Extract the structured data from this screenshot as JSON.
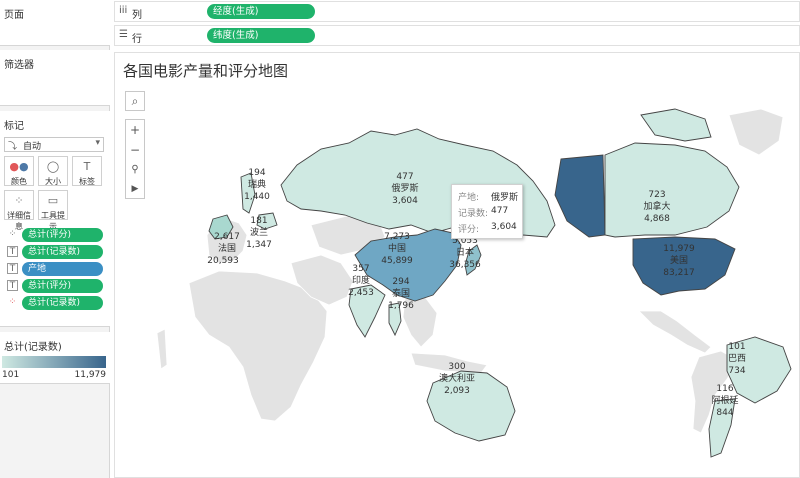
{
  "left_panel": {
    "pages_title": "页面",
    "filters_title": "筛选器",
    "marks": {
      "title": "标记",
      "mark_type": "自动",
      "buttons": [
        {
          "label": "颜色",
          "icon": "color-dots-icon"
        },
        {
          "label": "大小",
          "icon": "size-circles-icon"
        },
        {
          "label": "标签",
          "icon": "label-t-icon"
        },
        {
          "label": "详细信息",
          "icon": "detail-dots-icon"
        },
        {
          "label": "工具提示",
          "icon": "tooltip-bubble-icon"
        }
      ],
      "fields": [
        {
          "label": "总计(评分)",
          "type": "detail",
          "color": "#1fb36b"
        },
        {
          "label": "总计(记录数)",
          "type": "label",
          "color": "#1fb36b"
        },
        {
          "label": "产地",
          "type": "label",
          "color": "#3b8fc4"
        },
        {
          "label": "总计(评分)",
          "type": "label",
          "color": "#1fb36b"
        },
        {
          "label": "总计(记录数)",
          "type": "color",
          "color": "#1fb36b"
        }
      ]
    },
    "legend": {
      "title": "总计(记录数)",
      "min": "101",
      "max": "11,979",
      "color_low": "#cfe9e2",
      "color_high": "#38658c"
    }
  },
  "shelves": {
    "columns": {
      "label": "列",
      "pill": "经度(生成)"
    },
    "rows": {
      "label": "行",
      "pill": "纬度(生成)"
    }
  },
  "map": {
    "title": "各国电影产量和评分地图",
    "tools": {
      "search": "search-icon",
      "zoom_in": "+",
      "zoom_out": "−",
      "pin": "pin-icon",
      "arrow": "play-arrow-icon"
    },
    "countries": [
      {
        "name": "俄罗斯",
        "count": "477",
        "score": "3,604"
      },
      {
        "name": "瑞典",
        "count": "194",
        "score": "1,440"
      },
      {
        "name": "波兰",
        "count": "181",
        "score": "1,347"
      },
      {
        "name": "法国",
        "count": "2,617",
        "score": "20,593"
      },
      {
        "name": "中国",
        "count": "7,273",
        "score": "45,899"
      },
      {
        "name": "日本",
        "count": "5,053",
        "score": "36,356"
      },
      {
        "name": "印度",
        "count": "357",
        "score": "2,453"
      },
      {
        "name": "泰国",
        "count": "294",
        "score": "1,796"
      },
      {
        "name": "澳大利亚",
        "count": "300",
        "score": "2,093"
      },
      {
        "name": "加拿大",
        "count": "723",
        "score": "4,868"
      },
      {
        "name": "美国",
        "count": "11,979",
        "score": "83,217"
      },
      {
        "name": "巴西",
        "count": "101",
        "score": "734"
      },
      {
        "name": "阿根廷",
        "count": "116",
        "score": "844"
      }
    ],
    "tooltip": {
      "rows": [
        {
          "key": "产地:",
          "value": "俄罗斯"
        },
        {
          "key": "记录数:",
          "value": "477"
        },
        {
          "key": "评分:",
          "value": "3,604"
        }
      ]
    }
  }
}
